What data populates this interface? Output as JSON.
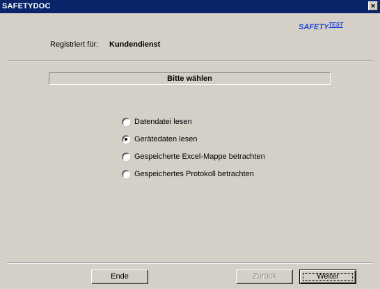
{
  "window": {
    "title": "SAFETYDOC",
    "close_glyph": "×"
  },
  "logo": {
    "main": "SAFETY",
    "sup": "TEST"
  },
  "registration": {
    "label": "Registriert für:",
    "value": "Kundendienst"
  },
  "panel": {
    "heading": "Bitte wählen"
  },
  "options": [
    {
      "label": "Datendatei lesen",
      "checked": false
    },
    {
      "label": "Gerätedaten lesen",
      "checked": true
    },
    {
      "label": "Gespeicherte Excel-Mappe betrachten",
      "checked": false
    },
    {
      "label": "Gespeichertes Protokoll betrachten",
      "checked": false
    }
  ],
  "buttons": {
    "end": "Ende",
    "back": "Zurück",
    "next": "Weiter"
  },
  "colors": {
    "titlebar": "#0a246a",
    "dialog": "#d4d0c8",
    "logo": "#1a3fd6"
  }
}
